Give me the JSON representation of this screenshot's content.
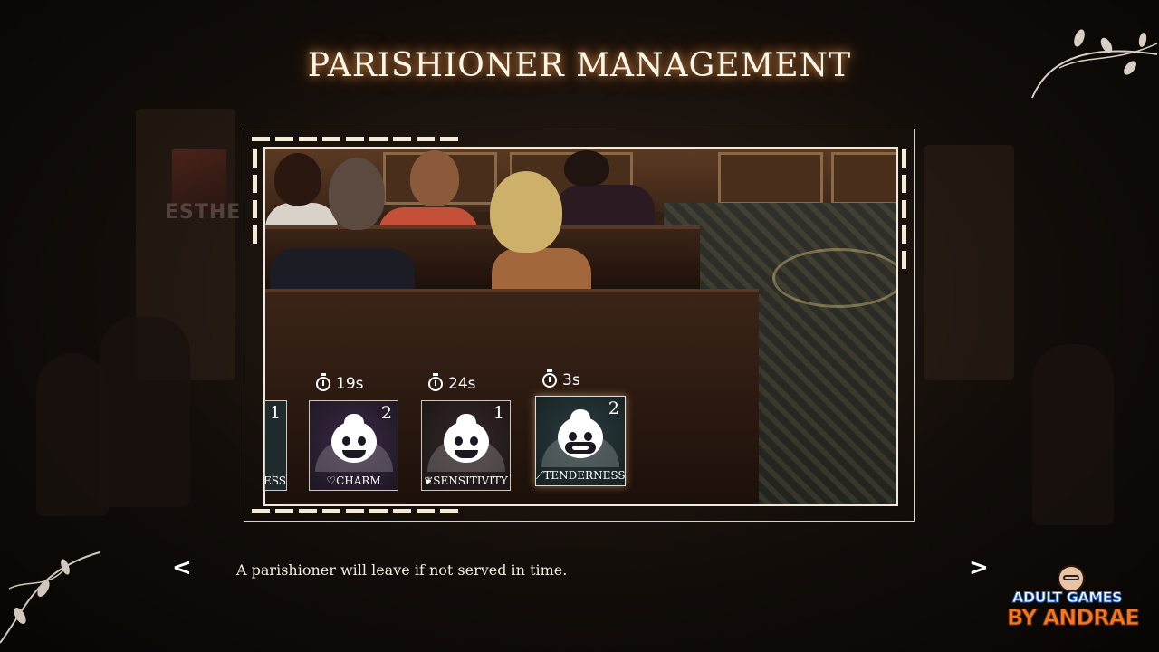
{
  "screen": {
    "title": "PARISHIONER MANAGEMENT",
    "hint": "A parishioner will leave if not served in time.",
    "nav_prev": "<",
    "nav_next": ">"
  },
  "background": {
    "character_name": "ESTHE"
  },
  "parishioners": [
    {
      "id": "partial",
      "label": "ESS",
      "count": "1",
      "timer": ""
    },
    {
      "id": "charm",
      "label": "CHARM",
      "count": "2",
      "timer": "19s"
    },
    {
      "id": "sensitivity",
      "label": "SENSITIVITY",
      "count": "1",
      "timer": "24s"
    },
    {
      "id": "tenderness",
      "label": "TENDERNESS",
      "count": "2",
      "timer": "3s"
    }
  ],
  "watermark": {
    "line1": "ADULT GAMES",
    "line2": "BY ANDRAE"
  },
  "colors": {
    "title_glow": "#e67828",
    "card_charm_bg": "#2a1f2e",
    "card_sensitivity_bg": "#241c1c",
    "card_tenderness_bg": "#1e2a2c",
    "frame": "#efe9e0"
  },
  "icons": [
    "clock-icon",
    "heart-gem-icon",
    "wave-icon",
    "feather-icon",
    "left-arrow-icon",
    "right-arrow-icon"
  ]
}
